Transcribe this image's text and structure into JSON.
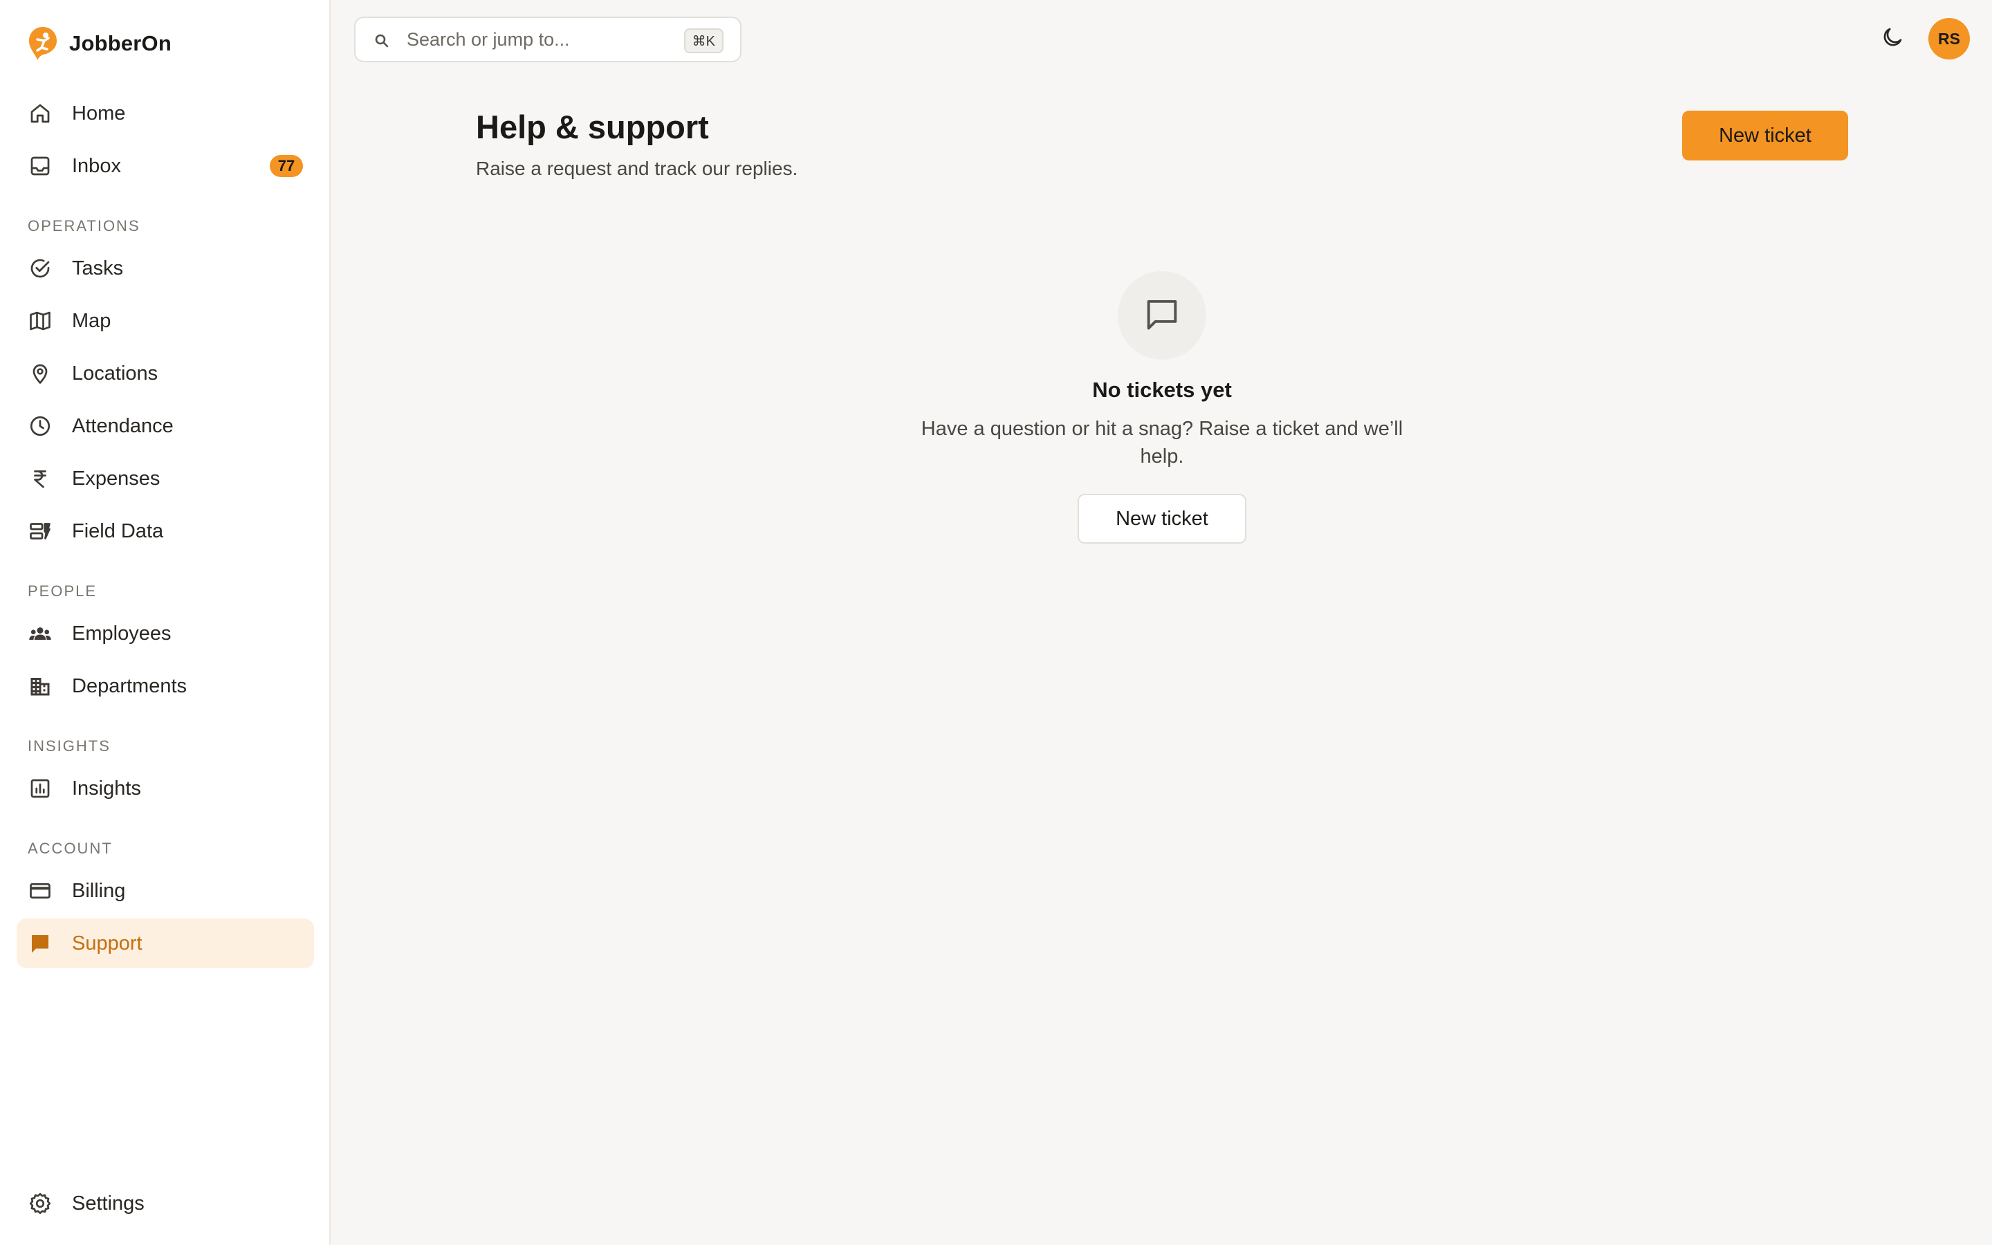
{
  "app": {
    "name": "JobberOn"
  },
  "sidebar": {
    "items": [
      {
        "label": "Home",
        "icon": "home-icon"
      },
      {
        "label": "Inbox",
        "icon": "inbox-icon",
        "badge": "77"
      }
    ],
    "sections": [
      {
        "title": "OPERATIONS",
        "items": [
          {
            "label": "Tasks",
            "icon": "check-circle-icon"
          },
          {
            "label": "Map",
            "icon": "map-icon"
          },
          {
            "label": "Locations",
            "icon": "location-pin-icon"
          },
          {
            "label": "Attendance",
            "icon": "clock-icon"
          },
          {
            "label": "Expenses",
            "icon": "rupee-icon"
          },
          {
            "label": "Field Data",
            "icon": "field-data-icon"
          }
        ]
      },
      {
        "title": "PEOPLE",
        "items": [
          {
            "label": "Employees",
            "icon": "people-icon"
          },
          {
            "label": "Departments",
            "icon": "building-icon"
          }
        ]
      },
      {
        "title": "INSIGHTS",
        "items": [
          {
            "label": "Insights",
            "icon": "bar-chart-icon"
          }
        ]
      },
      {
        "title": "ACCOUNT",
        "items": [
          {
            "label": "Billing",
            "icon": "credit-card-icon"
          },
          {
            "label": "Support",
            "icon": "chat-icon",
            "active": true
          }
        ]
      }
    ],
    "footer": {
      "label": "Settings",
      "icon": "gear-icon"
    }
  },
  "topbar": {
    "search_placeholder": "Search or jump to...",
    "search_shortcut": "⌘K",
    "theme_icon": "moon-icon",
    "avatar_initials": "RS"
  },
  "page": {
    "title": "Help & support",
    "subtitle": "Raise a request and track our replies.",
    "primary_action": "New ticket"
  },
  "empty_state": {
    "icon": "chat-icon",
    "title": "No tickets yet",
    "description": "Have a question or hit a snag? Raise a ticket and we’ll help.",
    "action": "New ticket"
  },
  "colors": {
    "accent": "#f39423",
    "active_text": "#c46f10",
    "active_bg": "#fdf0e1",
    "background": "#f7f6f4"
  }
}
